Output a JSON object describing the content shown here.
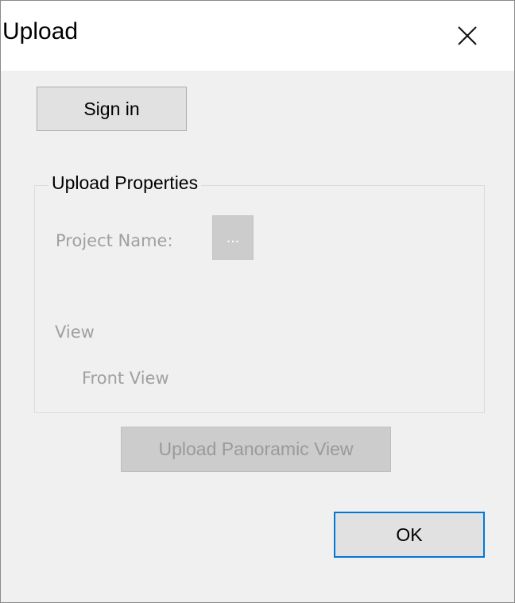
{
  "window": {
    "title": "Upload",
    "close_icon": "close-icon"
  },
  "sign_in": {
    "label": "Sign in"
  },
  "upload_properties": {
    "group_title": "Upload Properties",
    "project_name_label": "Project Name:",
    "browse_label": "...",
    "view_label": "View",
    "front_view_label": "Front View"
  },
  "actions": {
    "upload_panoramic_label": "Upload Panoramic View",
    "ok_label": "OK"
  },
  "colors": {
    "dialog_background": "#f0f0f0",
    "titlebar_background": "#ffffff",
    "default_button_border": "#0078d7",
    "disabled_text": "#a0a0a0"
  }
}
